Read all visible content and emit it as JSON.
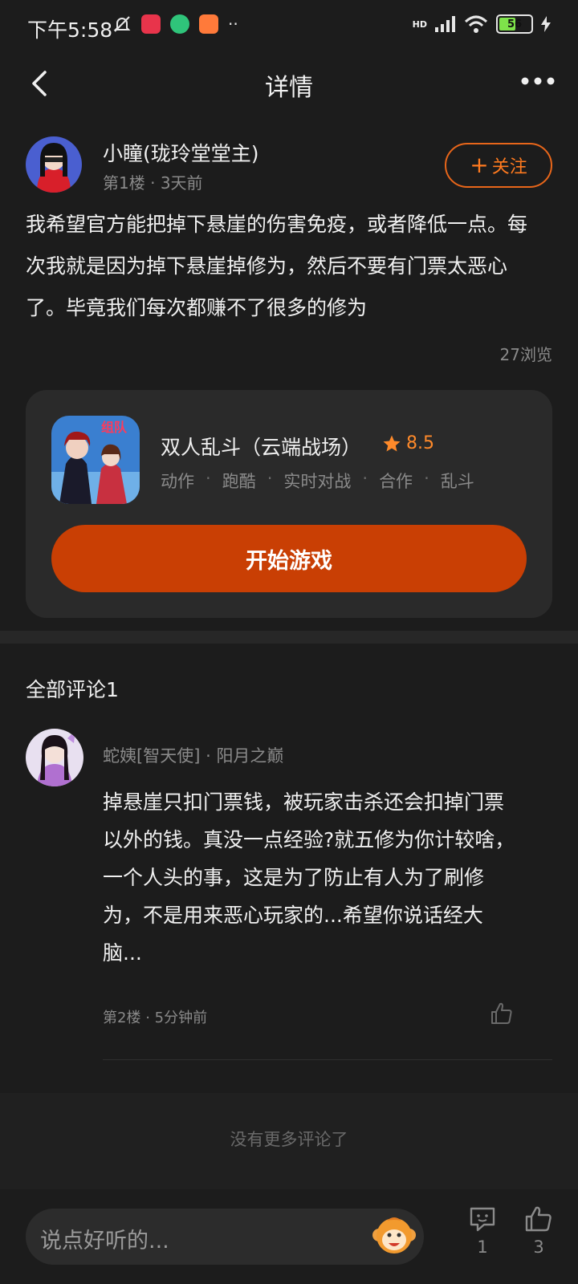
{
  "status_bar": {
    "time": "下午5:58",
    "network": "HD",
    "battery": "56",
    "battery_level_percent": 56
  },
  "nav": {
    "title": "详情",
    "back_icon": "chevron-left-icon",
    "more_icon": "more-dots-icon"
  },
  "post": {
    "author": "小瞳(珑玲堂堂主)",
    "floor": "第1楼",
    "time": "3天前",
    "follow_label": "关注",
    "body": "我希望官方能把掉下悬崖的伤害免疫，或者降低一点。每次我就是因为掉下悬崖掉修为，然后不要有门票太恶心了。毕竟我们每次都赚不了很多的修为",
    "views": "27浏览"
  },
  "game": {
    "title": "双人乱斗（云端战场）",
    "rating": "8.5",
    "tags": [
      "动作",
      "跑酷",
      "实时对战",
      "合作",
      "乱斗"
    ],
    "icon_text": "组队",
    "play_label": "开始游戏"
  },
  "comments": {
    "header": "全部评论1",
    "items": [
      {
        "author": "蛇姨[智天使]",
        "title": "阳月之巅",
        "body": "掉悬崖只扣门票钱，被玩家击杀还会扣掉门票以外的钱。真没一点经验?就五修为你计较啥，一个人头的事，这是为了防止有人为了刷修为，不是用来恶心玩家的...希望你说话经大脑...",
        "floor": "第2楼",
        "time": "5分钟前"
      }
    ],
    "no_more": "没有更多评论了"
  },
  "bottom_bar": {
    "input_placeholder": "说点好听的...",
    "comment_count": "1",
    "like_count": "3"
  },
  "colors": {
    "background": "#1c1c1c",
    "card": "#2a2a2a",
    "accent_orange": "#ff7a1f",
    "play_button": "#c93f04"
  }
}
